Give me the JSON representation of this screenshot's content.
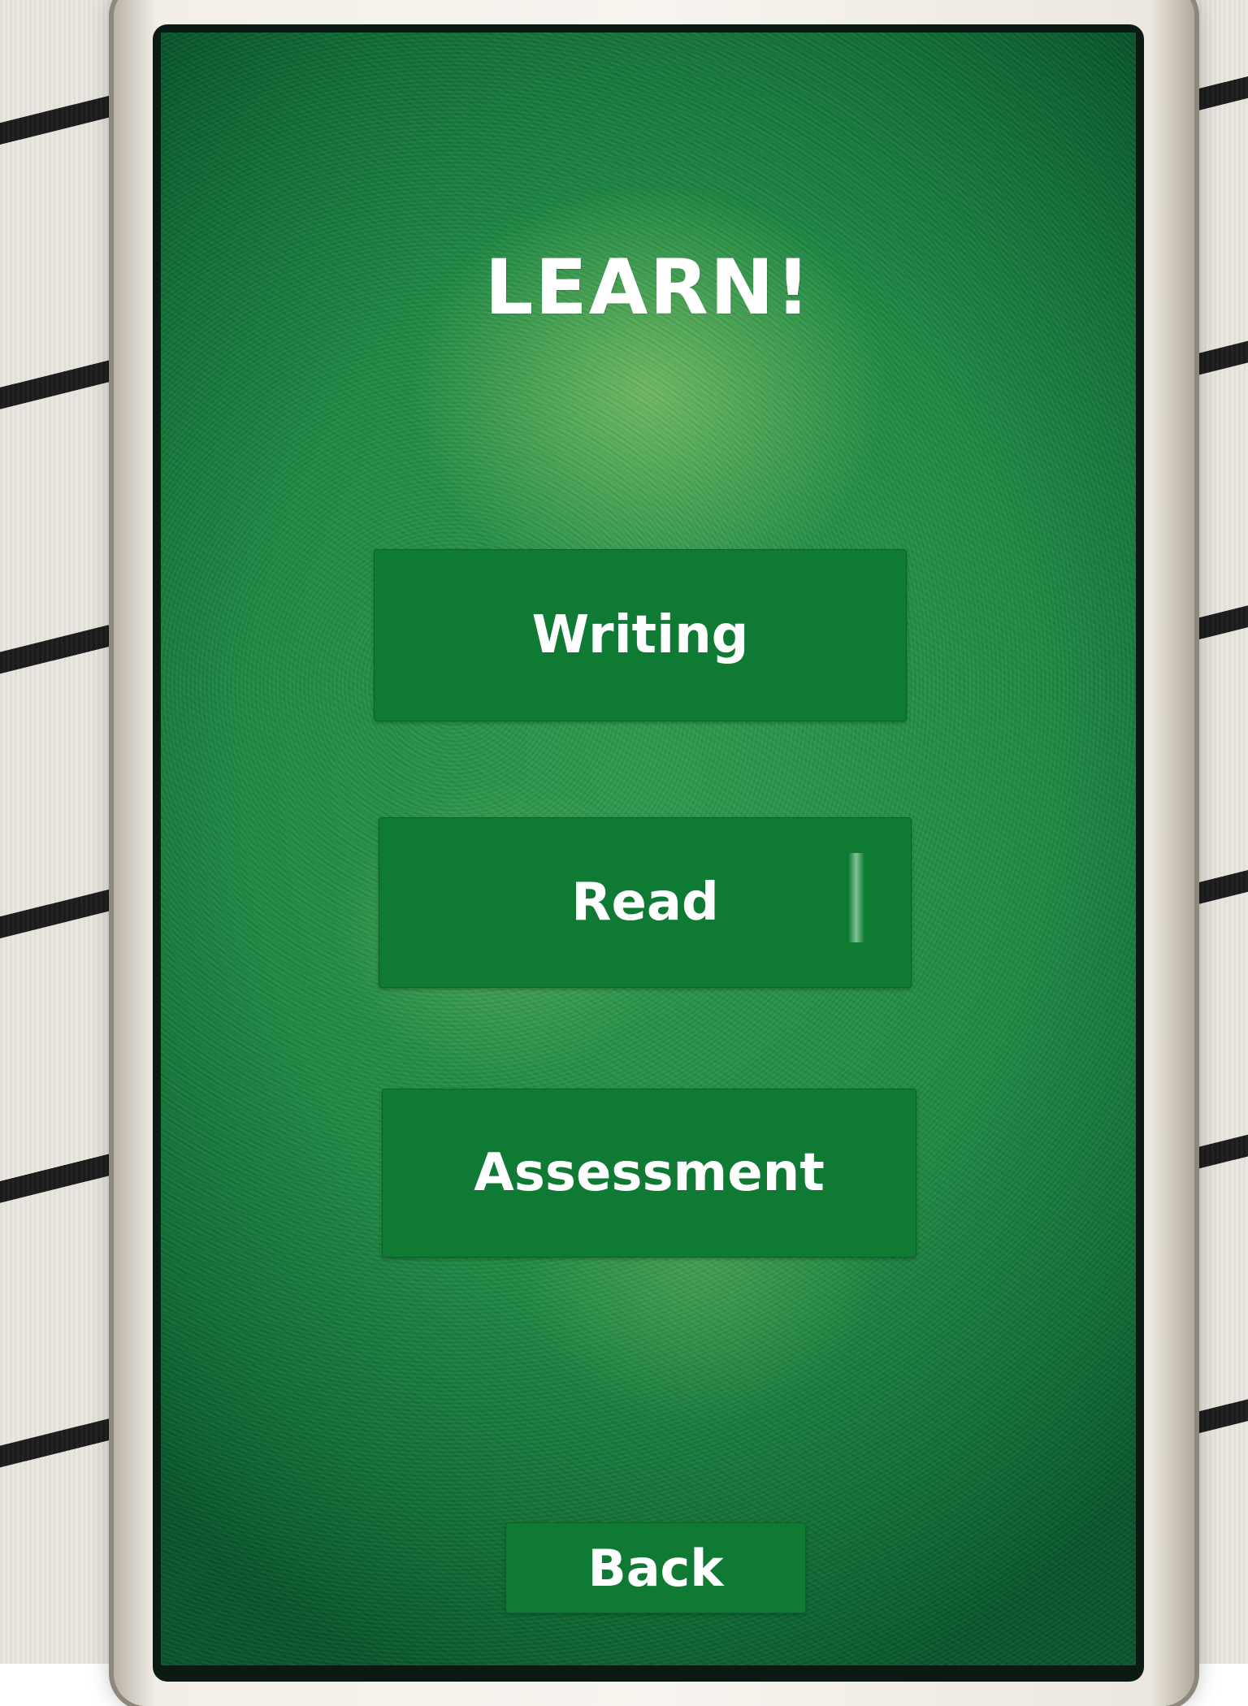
{
  "screen": {
    "title": "LEARN!",
    "menu": [
      {
        "label": "Writing"
      },
      {
        "label": "Read"
      },
      {
        "label": "Assessment"
      }
    ],
    "back_label": "Back"
  },
  "colors": {
    "button_green": "#0f7a34",
    "background_green": "#1f8a44",
    "text": "#ffffff"
  }
}
